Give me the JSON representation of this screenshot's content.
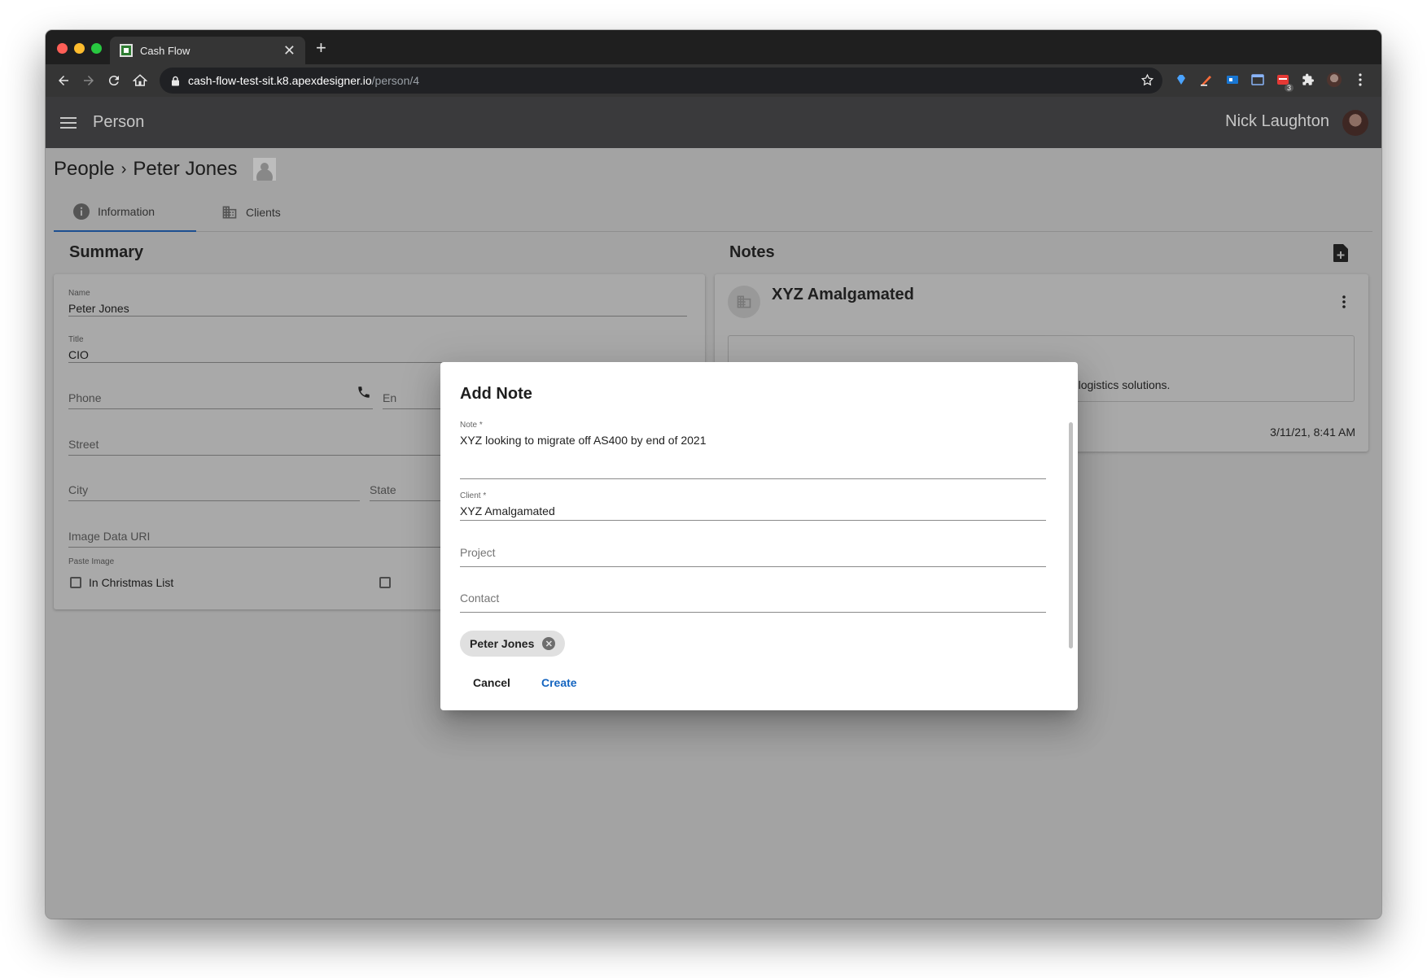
{
  "browser": {
    "tab_title": "Cash Flow",
    "new_tab": "+",
    "close": "✕",
    "url_host": "cash-flow-test-sit.k8.apexdesigner.io",
    "url_path": "/person/4",
    "extension_badge": "3"
  },
  "appbar": {
    "title": "Person",
    "user_name": "Nick Laughton"
  },
  "breadcrumb": {
    "parent": "People",
    "separator": "›",
    "current": "Peter Jones"
  },
  "tabs": [
    {
      "label": "Information",
      "icon": "info-icon",
      "active": true
    },
    {
      "label": "Clients",
      "icon": "building-icon",
      "active": false
    }
  ],
  "summary": {
    "title": "Summary",
    "name_label": "Name",
    "name_value": "Peter Jones",
    "title_label": "Title",
    "title_value": "CIO",
    "phone_placeholder": "Phone",
    "email_placeholder_partial": "En",
    "street_placeholder": "Street",
    "city_placeholder": "City",
    "state_placeholder_partial": "State",
    "image_uri_placeholder": "Image Data URI",
    "paste_image_label": "Paste Image",
    "christmas_list_label": "In Christmas List"
  },
  "notes": {
    "title": "Notes",
    "client_name": "XYZ Amalgamated",
    "note_text_partial": "rested in logistics solutions.",
    "timestamp": "3/11/21, 8:41 AM"
  },
  "dialog": {
    "title": "Add Note",
    "note_label": "Note *",
    "note_value": "XYZ looking to migrate off AS400 by end of 2021",
    "client_label": "Client *",
    "client_value": "XYZ Amalgamated",
    "project_placeholder": "Project",
    "contact_placeholder": "Contact",
    "chip_label": "Peter Jones",
    "chip_remove": "✕",
    "cancel_label": "Cancel",
    "create_label": "Create"
  },
  "colors": {
    "primary": "#1565c0",
    "app_bar": "#3a3a3c",
    "overlay_bg": "#a3a3a3",
    "chip": "#e0e0e0"
  }
}
